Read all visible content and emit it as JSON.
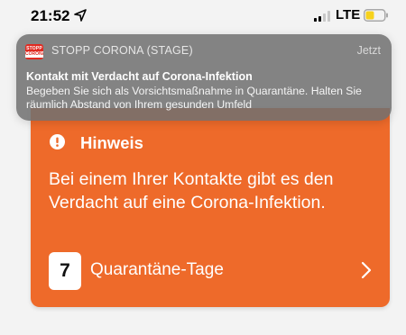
{
  "status_bar": {
    "time": "21:52",
    "carrier": "LTE",
    "icons": [
      "location-arrow-icon",
      "signal-bars-icon",
      "battery-icon"
    ]
  },
  "notification": {
    "app_name": "STOPP CORONA (STAGE)",
    "app_icon_text_top": "STOPP",
    "app_icon_text_bottom": "CORONA",
    "time": "Jetzt",
    "title": "Kontakt mit Verdacht auf Corona-Infektion",
    "body": "Begeben Sie sich als Vorsichtsmaßnahme in Quarantäne. Halten Sie räumlich Abstand von Ihrem gesunden Umfeld"
  },
  "card": {
    "title": "Hinweis",
    "text": "Bei einem Ihrer Kontakte gibt es den Verdacht auf eine Corona-Infektion.",
    "quarantine_days": "7",
    "quarantine_label": "Quarantäne-Tage",
    "icons": [
      "info-exclamation-icon",
      "chevron-right-icon"
    ]
  },
  "colors": {
    "card_orange": "#ee6a2a",
    "notification_bg": "#707070",
    "app_icon_red": "#e02a21",
    "battery_yellow": "#f7d21c"
  }
}
